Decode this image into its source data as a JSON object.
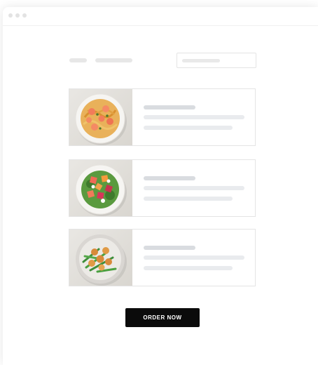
{
  "window": {
    "controls": [
      "window-dot",
      "window-dot",
      "window-dot"
    ]
  },
  "header": {
    "nav_placeholders": 2,
    "search_icon": "search-field-placeholder"
  },
  "menu": {
    "items": [
      {
        "dish": "shrimp-pasta-image",
        "colors": [
          "#f4f3f0",
          "#e8a24a",
          "#f07a4f"
        ]
      },
      {
        "dish": "beet-citrus-salad-image",
        "colors": [
          "#f4f3f0",
          "#e8624f",
          "#4f8a3a"
        ]
      },
      {
        "dish": "scallop-green-bean-image",
        "colors": [
          "#f4f3f0",
          "#d88a3a",
          "#3e8e3a"
        ]
      }
    ]
  },
  "cta": {
    "label": "ORDER NOW",
    "background": "#0b0b0b",
    "text_color": "#ffffff"
  }
}
